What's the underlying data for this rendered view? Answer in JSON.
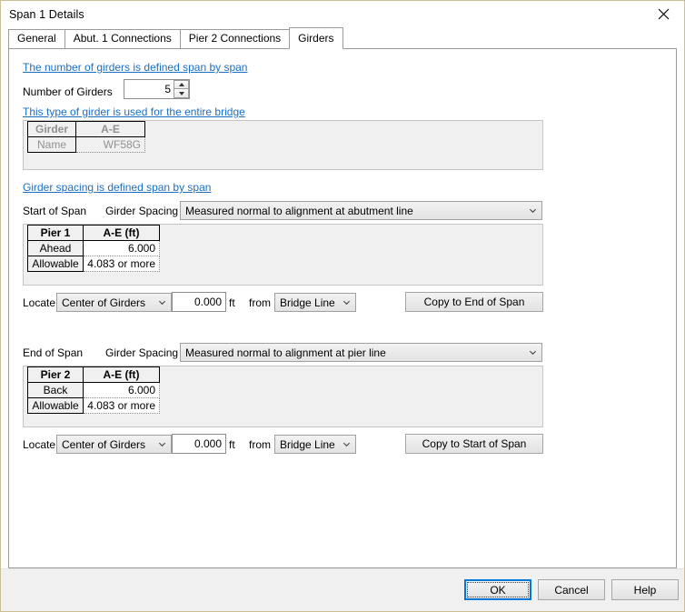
{
  "window": {
    "title": "Span 1 Details",
    "close_icon": "close-icon"
  },
  "tabs": [
    {
      "label": "General",
      "selected": false
    },
    {
      "label": "Abut. 1 Connections",
      "selected": false
    },
    {
      "label": "Pier 2 Connections",
      "selected": false
    },
    {
      "label": "Girders",
      "selected": true
    }
  ],
  "girders_tab": {
    "link_number_of_girders": "The number of girders is defined span by span",
    "number_of_girders_label": "Number of Girders",
    "number_of_girders_value": "5",
    "link_girder_type": "This type of girder is used for the entire bridge",
    "girder_type_grid": {
      "headers": [
        "Girder",
        "A-E"
      ],
      "rows": [
        {
          "label": "Name",
          "values": [
            "WF58G"
          ]
        }
      ]
    },
    "link_girder_spacing": "Girder spacing is defined span by span",
    "start_of_span": {
      "section_label": "Start of Span",
      "spacing_label": "Girder Spacing",
      "spacing_value": "Measured normal to alignment at abutment line",
      "grid": {
        "headers": [
          "Pier 1",
          "A-E (ft)"
        ],
        "rows": [
          {
            "label": "Ahead",
            "values": [
              "6.000"
            ]
          },
          {
            "label": "Allowable",
            "values": [
              "4.083 or more"
            ]
          }
        ]
      },
      "locate_label": "Locate",
      "locate_value": "Center of Girders",
      "offset_value": "0.000",
      "units_label": "ft",
      "from_label": "from",
      "from_value": "Bridge Line",
      "copy_button": "Copy to End of Span"
    },
    "end_of_span": {
      "section_label": "End of Span",
      "spacing_label": "Girder Spacing",
      "spacing_value": "Measured normal to alignment at pier line",
      "grid": {
        "headers": [
          "Pier 2",
          "A-E (ft)"
        ],
        "rows": [
          {
            "label": "Back",
            "values": [
              "6.000"
            ]
          },
          {
            "label": "Allowable",
            "values": [
              "4.083 or more"
            ]
          }
        ]
      },
      "locate_label": "Locate",
      "locate_value": "Center of Girders",
      "offset_value": "0.000",
      "units_label": "ft",
      "from_label": "from",
      "from_value": "Bridge Line",
      "copy_button": "Copy to Start of Span"
    }
  },
  "footer": {
    "ok": "OK",
    "cancel": "Cancel",
    "help": "Help"
  },
  "colors": {
    "link": "#1b6fc4",
    "window_border": "#cbbe92",
    "default_button_focus": "#0078d7",
    "disabled_text": "#919191",
    "panel_bg": "#f0f0f0"
  }
}
